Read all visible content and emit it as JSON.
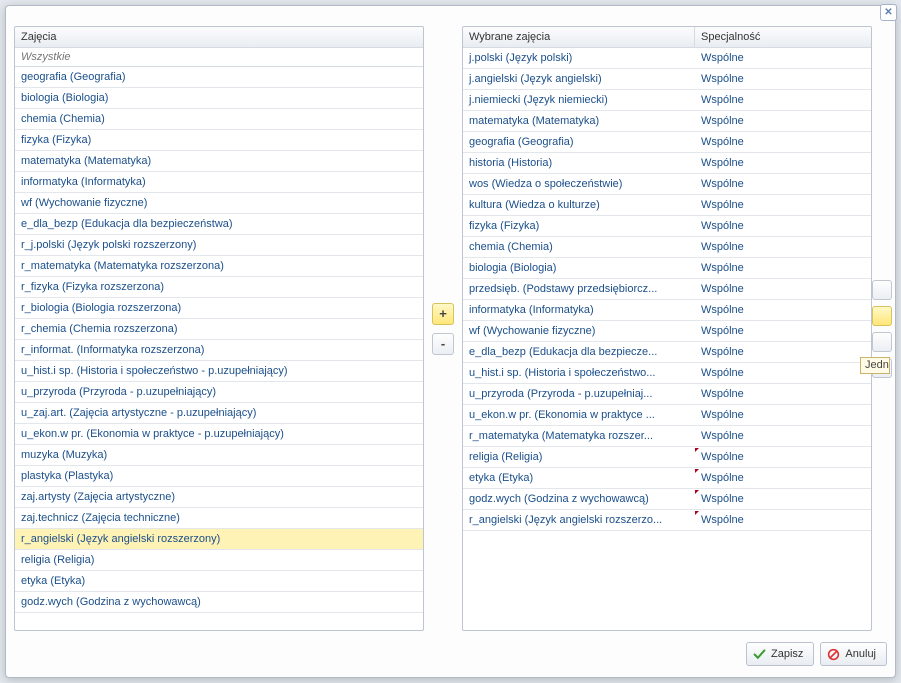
{
  "close_label": "✕",
  "left": {
    "header": "Zajęcia",
    "filter_placeholder": "Wszystkie",
    "items": [
      "geografia (Geografia)",
      "biologia (Biologia)",
      "chemia (Chemia)",
      "fizyka (Fizyka)",
      "matematyka (Matematyka)",
      "informatyka (Informatyka)",
      "wf (Wychowanie fizyczne)",
      "e_dla_bezp (Edukacja dla bezpieczeństwa)",
      "r_j.polski (Język polski rozszerzony)",
      "r_matematyka (Matematyka rozszerzona)",
      "r_fizyka (Fizyka rozszerzona)",
      "r_biologia (Biologia rozszerzona)",
      "r_chemia (Chemia rozszerzona)",
      "r_informat. (Informatyka rozszerzona)",
      "u_hist.i sp. (Historia i społeczeństwo - p.uzupełniający)",
      "u_przyroda (Przyroda - p.uzupełniający)",
      "u_zaj.art. (Zajęcia artystyczne - p.uzupełniający)",
      "u_ekon.w pr. (Ekonomia w praktyce - p.uzupełniający)",
      "muzyka (Muzyka)",
      "plastyka (Plastyka)",
      "zaj.artysty (Zajęcia artystyczne)",
      "zaj.technicz (Zajęcia techniczne)",
      "r_angielski (Język angielski rozszerzony)",
      "religia (Religia)",
      "etyka (Etyka)",
      "godz.wych (Godzina z wychowawcą)"
    ],
    "selected_index": 22
  },
  "mid": {
    "add": "+",
    "remove": "-"
  },
  "right": {
    "header_subject": "Wybrane zajęcia",
    "header_spec": "Specjalność",
    "rows": [
      {
        "subject": "j.polski (Język polski)",
        "spec": "Wspólne",
        "dirty": false
      },
      {
        "subject": "j.angielski (Język angielski)",
        "spec": "Wspólne",
        "dirty": false
      },
      {
        "subject": "j.niemiecki (Język niemiecki)",
        "spec": "Wspólne",
        "dirty": false
      },
      {
        "subject": "matematyka (Matematyka)",
        "spec": "Wspólne",
        "dirty": false
      },
      {
        "subject": "geografia (Geografia)",
        "spec": "Wspólne",
        "dirty": false
      },
      {
        "subject": "historia (Historia)",
        "spec": "Wspólne",
        "dirty": false
      },
      {
        "subject": "wos (Wiedza o społeczeństwie)",
        "spec": "Wspólne",
        "dirty": false
      },
      {
        "subject": "kultura (Wiedza o kulturze)",
        "spec": "Wspólne",
        "dirty": false
      },
      {
        "subject": "fizyka (Fizyka)",
        "spec": "Wspólne",
        "dirty": false
      },
      {
        "subject": "chemia (Chemia)",
        "spec": "Wspólne",
        "dirty": false
      },
      {
        "subject": "biologia (Biologia)",
        "spec": "Wspólne",
        "dirty": false
      },
      {
        "subject": "przedsięb. (Podstawy przedsiębiorcz...",
        "spec": "Wspólne",
        "dirty": false
      },
      {
        "subject": "informatyka (Informatyka)",
        "spec": "Wspólne",
        "dirty": false
      },
      {
        "subject": "wf (Wychowanie fizyczne)",
        "spec": "Wspólne",
        "dirty": false
      },
      {
        "subject": "e_dla_bezp (Edukacja dla bezpiecze...",
        "spec": "Wspólne",
        "dirty": false
      },
      {
        "subject": "u_hist.i sp. (Historia i społeczeństwo...",
        "spec": "Wspólne",
        "dirty": false
      },
      {
        "subject": "u_przyroda (Przyroda - p.uzupełniaj...",
        "spec": "Wspólne",
        "dirty": false
      },
      {
        "subject": "u_ekon.w pr. (Ekonomia w praktyce ...",
        "spec": "Wspólne",
        "dirty": false
      },
      {
        "subject": "r_matematyka (Matematyka rozszer...",
        "spec": "Wspólne",
        "dirty": false
      },
      {
        "subject": "religia (Religia)",
        "spec": "Wspólne",
        "dirty": true
      },
      {
        "subject": "etyka (Etyka)",
        "spec": "Wspólne",
        "dirty": true
      },
      {
        "subject": "godz.wych (Godzina z wychowawcą)",
        "spec": "Wspólne",
        "dirty": true
      },
      {
        "subject": "r_angielski (Język angielski rozszerzo...",
        "spec": "Wspólne",
        "dirty": true
      }
    ]
  },
  "reorder": {
    "top": "⤒",
    "up": "▲",
    "down": "▼",
    "bottom": "⤓",
    "tooltip": "Jedn"
  },
  "footer": {
    "save": "Zapisz",
    "cancel": "Anuluj"
  }
}
